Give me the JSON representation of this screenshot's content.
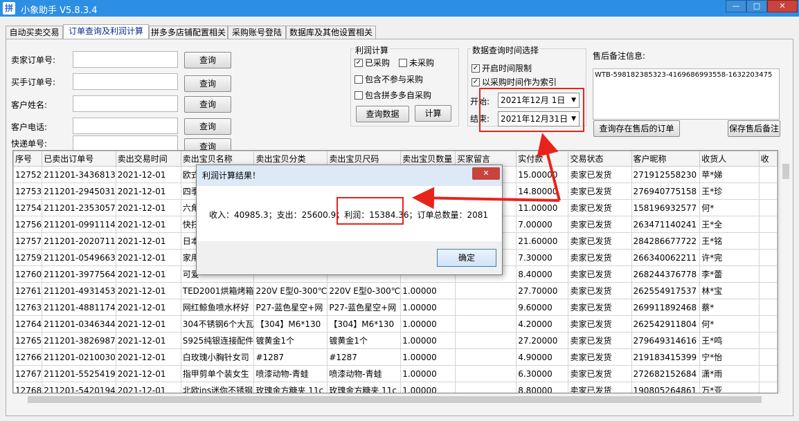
{
  "window": {
    "title": "小象助手 V5.8.3.4",
    "icon_text": "拼",
    "minimize": "—",
    "maximize": "□",
    "close": "✕"
  },
  "tabs": [
    {
      "label": "自动买卖交易"
    },
    {
      "label": "订单查询及利润计算"
    },
    {
      "label": "拼多多店铺配置相关"
    },
    {
      "label": "采购账号登陆"
    },
    {
      "label": "数据库及其他设置相关"
    }
  ],
  "search": {
    "seller_order_label": "卖家订单号:",
    "buyer_order_label": "买手订单号:",
    "customer_name_label": "客户姓名:",
    "customer_phone_label": "客户电话:",
    "express_label": "快递单号:",
    "query_label": "查询"
  },
  "profit": {
    "group_label": "利润计算",
    "purchased": "已采购",
    "not_purchased": "未采购",
    "exclude": "包含不参与采购",
    "include_pdd": "包含拼多多自采购",
    "query_data": "查询数据",
    "calc": "计算"
  },
  "timefilter": {
    "group_label": "数据查询时间选择",
    "enable_limit": "开启时间限制",
    "use_purchase_time": "以采购时间作为索引",
    "start_label": "开始:",
    "start_value": "2021年12月 1日",
    "end_label": "结束:",
    "end_value": "2021年12月31日"
  },
  "aftersale": {
    "label": "售后备注信息:",
    "memo": "WTB-598182385323-4169686993558-1632203475",
    "query_btn": "查询存在售后的订单",
    "save_btn": "保存售后备注"
  },
  "table": {
    "columns": [
      "序号",
      "已卖出订单号",
      "卖出交易时间",
      "卖出宝贝名称",
      "卖出宝贝分类",
      "卖出宝贝尺码",
      "卖出宝贝数量",
      "买家留言",
      "实付款",
      "交易状态",
      "客户昵称",
      "收货人",
      "收"
    ],
    "rows": [
      [
        "12752",
        "211201-3436813",
        "2021-12-01",
        "欧式",
        "",
        "",
        "",
        "",
        "15.00000",
        "卖家已发货",
        "271912558230",
        "苹*娣",
        ""
      ],
      [
        "12753",
        "211201-2945031",
        "2021-12-01",
        "四季",
        "",
        "",
        "",
        "",
        "14.80000",
        "卖家已发货",
        "276940775158",
        "王*珍",
        ""
      ],
      [
        "12754",
        "211201-2353057",
        "2021-12-01",
        "六角",
        "",
        "",
        "",
        "",
        "11.00000",
        "卖家已发货",
        "158196932577",
        "何*",
        ""
      ],
      [
        "12756",
        "211201-0991114",
        "2021-12-01",
        "快扫",
        "",
        "",
        "",
        "",
        "7.00000",
        "卖家已发货",
        "263471140241",
        "王*全",
        ""
      ],
      [
        "12757",
        "211201-2020711",
        "2021-12-01",
        "日本",
        "",
        "",
        "",
        "",
        "21.60000",
        "卖家已发货",
        "284286677722",
        "王*铭",
        ""
      ],
      [
        "12759",
        "211201-0549663",
        "2021-12-01",
        "家用",
        "",
        "",
        "",
        "",
        "7.30000",
        "卖家已发货",
        "266340062211",
        "许*完",
        ""
      ],
      [
        "12760",
        "211201-3977564",
        "2021-12-01",
        "可爱",
        "",
        "",
        "",
        "",
        "8.40000",
        "卖家已发货",
        "268244376778",
        "李*蕾",
        ""
      ],
      [
        "12761",
        "211201-4931453",
        "2021-12-01",
        "TED2001烘箱烤箱",
        "220V E型0-300℃",
        "220V E型0-300℃",
        "1.00000",
        "",
        "27.70000",
        "卖家已发货",
        "262554917537",
        "林*宝",
        ""
      ],
      [
        "12763",
        "211201-4881174",
        "2021-12-01",
        "网红鲸鱼喷水杯好",
        "P27-蓝色星空+网",
        "P27-蓝色星空+网",
        "1.00000",
        "",
        "9.60000",
        "卖家已发货",
        "269911892468",
        "蔡*",
        ""
      ],
      [
        "12764",
        "211201-0346344",
        "2021-12-01",
        "304不锈钢6个大瓦",
        "【304】M6*130",
        "【304】M6*130",
        "1.00000",
        "",
        "4.20000",
        "卖家已发货",
        "262542911804",
        "何*",
        ""
      ],
      [
        "12765",
        "211201-3826987",
        "2021-12-01",
        "S925纯银连接配件",
        "镀黄金1个",
        "镀黄金1个",
        "1.00000",
        "",
        "27.20000",
        "卖家已发货",
        "279649314616",
        "王*鸣",
        ""
      ],
      [
        "12766",
        "211201-0210030",
        "2021-12-01",
        "白玫瑰小胸针女司",
        "#1287",
        "#1287",
        "1.00000",
        "",
        "4.90000",
        "卖家已发货",
        "219183415399",
        "宁*怡",
        ""
      ],
      [
        "12767",
        "211201-5525419",
        "2021-12-01",
        "指甲剪单个装女生",
        "喷漆动物-青蛙",
        "喷漆动物-青蛙",
        "1.00000",
        "",
        "6.30000",
        "卖家已发货",
        "272682152684",
        "潇*雨",
        ""
      ],
      [
        "12768",
        "211201-5420194",
        "2021-12-01",
        "北欧ins迷你不锈钢",
        "玫瑰金方糖夹 11c",
        "玫瑰金方糖夹 11c",
        "1.00000",
        "",
        "8.80000",
        "卖家已发货",
        "190805264861",
        "万*亚",
        ""
      ]
    ]
  },
  "dialog": {
    "title": "利润计算结果！",
    "message": "收入：40985.3；支出：25600.9；利润：15384.36；订单总数量：2081",
    "ok": "确定",
    "close": "✕"
  }
}
